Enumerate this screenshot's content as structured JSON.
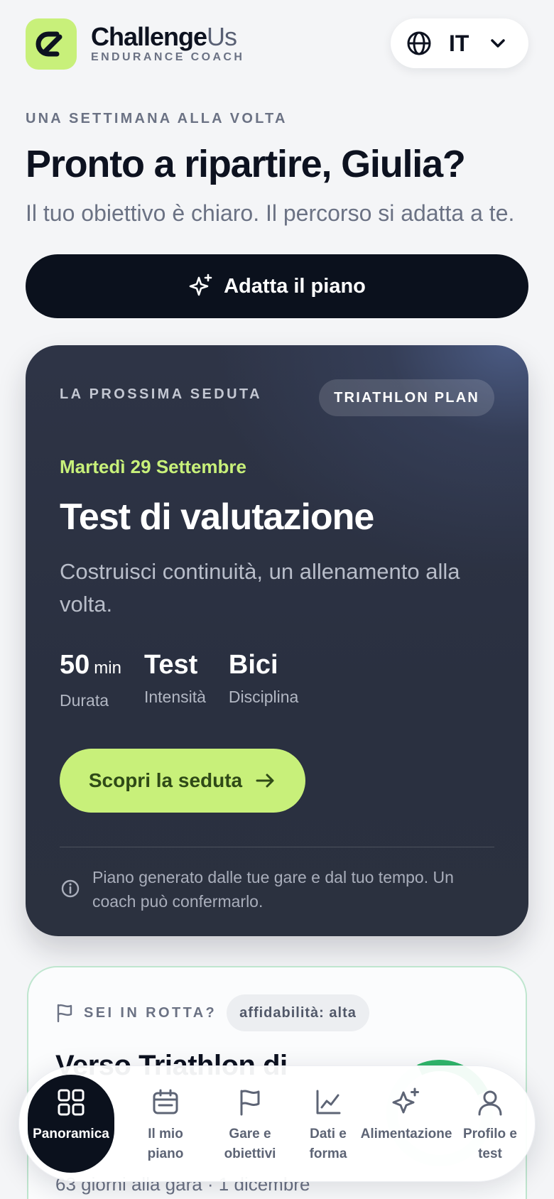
{
  "header": {
    "brand_bold": "Challenge",
    "brand_light": "Us",
    "brand_sub": "ENDURANCE COACH",
    "language": "IT"
  },
  "hero": {
    "eyebrow": "UNA SETTIMANA ALLA VOLTA",
    "title": "Pronto a ripartire, Giulia?",
    "subtitle": "Il tuo obiettivo è chiaro. Il percorso si adatta a te.",
    "cta_label": "Adatta il piano"
  },
  "next_session": {
    "eyebrow": "LA PROSSIMA SEDUTA",
    "badge": "TRIATHLON PLAN",
    "date": "Martedì 29 Settembre",
    "title": "Test di valutazione",
    "description": "Costruisci continuità, un allenamento alla volta.",
    "stats": [
      {
        "value": "50",
        "unit": "min",
        "label": "Durata"
      },
      {
        "value": "Test",
        "unit": "",
        "label": "Intensità"
      },
      {
        "value": "Bici",
        "unit": "",
        "label": "Disciplina"
      }
    ],
    "button_label": "Scopri la seduta",
    "note": "Piano generato dalle tue gare e dal tuo tempo. Un coach può confermarlo."
  },
  "on_track": {
    "eyebrow": "SEI IN ROTTA?",
    "badge": "affidabilità: alta",
    "title": "Verso Triathlon di",
    "subtitle": "63 giorni alla gara · 1 dicembre"
  },
  "tabbar": {
    "items": [
      {
        "line1": "Panoramica",
        "line2": ""
      },
      {
        "line1": "Il mio",
        "line2": "piano"
      },
      {
        "line1": "Gare e",
        "line2": "obiettivi"
      },
      {
        "line1": "Dati e",
        "line2": "forma"
      },
      {
        "line1": "Alimentazione",
        "line2": ""
      },
      {
        "line1": "Profilo e",
        "line2": "test"
      }
    ]
  },
  "colors": {
    "accent_lime": "#c8f07a",
    "dark": "#0b111d",
    "card_dark": "#2e3446",
    "success": "#2fb66a"
  }
}
